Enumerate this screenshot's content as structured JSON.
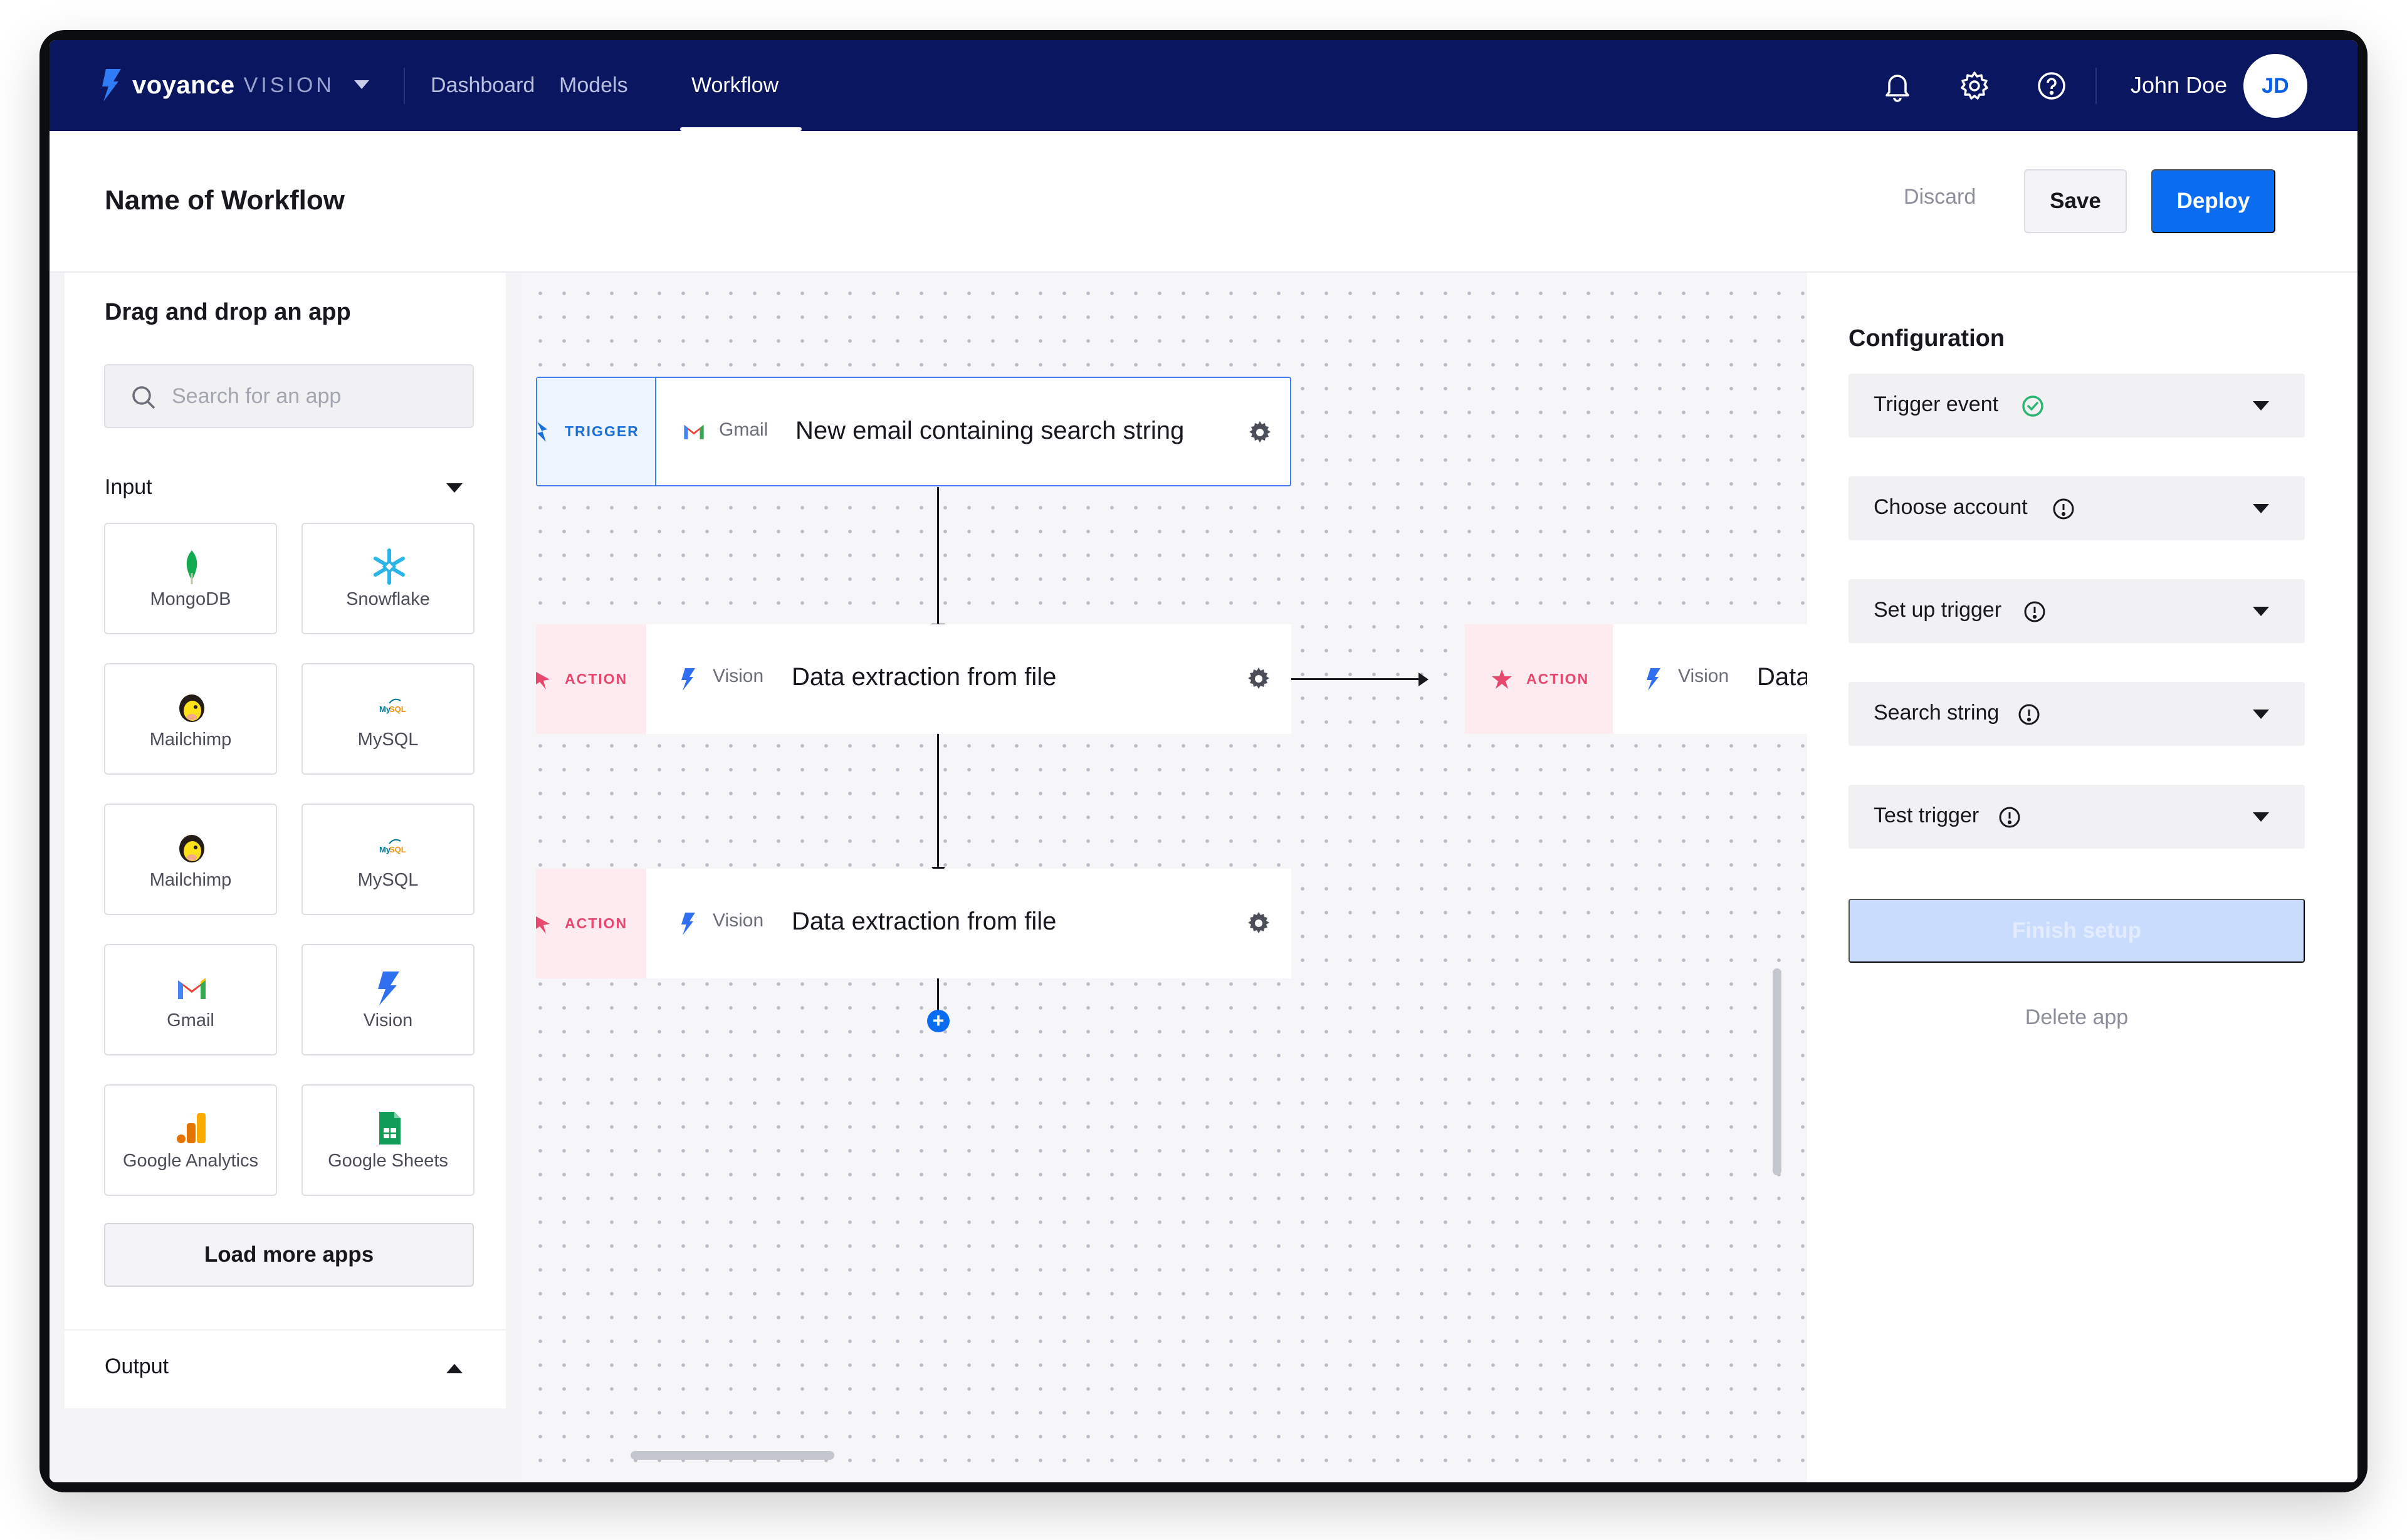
{
  "nav": {
    "brand_name": "voyance",
    "brand_suffix": "VISION",
    "links": [
      "Dashboard",
      "Models",
      "Workflow"
    ],
    "active": "Workflow",
    "user_name": "John Doe",
    "user_initials": "JD",
    "icons": [
      "bell-icon",
      "gear-icon",
      "help-icon"
    ]
  },
  "header": {
    "title": "Name of Workflow",
    "discard_label": "Discard",
    "save_label": "Save",
    "deploy_label": "Deploy"
  },
  "sidebar": {
    "title": "Drag and drop an app",
    "search_placeholder": "Search for an app",
    "input_section": "Input",
    "output_section": "Output",
    "apps": [
      {
        "name": "MongoDB",
        "icon": "mongodb-icon"
      },
      {
        "name": "Snowflake",
        "icon": "snowflake-icon"
      },
      {
        "name": "Mailchimp",
        "icon": "mailchimp-icon"
      },
      {
        "name": "MySQL",
        "icon": "mysql-icon"
      },
      {
        "name": "Mailchimp",
        "icon": "mailchimp-icon"
      },
      {
        "name": "MySQL",
        "icon": "mysql-icon"
      },
      {
        "name": "Gmail",
        "icon": "gmail-icon"
      },
      {
        "name": "Vision",
        "icon": "vision-icon"
      },
      {
        "name": "Google Analytics",
        "icon": "google-analytics-icon"
      },
      {
        "name": "Google Sheets",
        "icon": "google-sheets-icon"
      }
    ],
    "load_more_label": "Load more apps"
  },
  "canvas": {
    "nodes": [
      {
        "tag": "TRIGGER",
        "app": "Gmail",
        "text": "New email containing search string"
      },
      {
        "tag": "ACTION",
        "app": "Vision",
        "text": "Data extraction from file"
      },
      {
        "tag": "ACTION",
        "app": "Vision",
        "text": "Data extraction from file"
      },
      {
        "tag": "ACTION",
        "app": "Vision",
        "text": "Data"
      }
    ],
    "add_symbol": "+"
  },
  "config": {
    "title": "Configuration",
    "rows": [
      {
        "label": "Trigger event",
        "status": "complete"
      },
      {
        "label": "Choose account",
        "status": "info"
      },
      {
        "label": "Set up trigger",
        "status": "info"
      },
      {
        "label": "Search string",
        "status": "info"
      },
      {
        "label": "Test trigger",
        "status": "info"
      }
    ],
    "finish_label": "Finish setup",
    "delete_label": "Delete app"
  },
  "colors": {
    "nav_bg": "#0a1660",
    "primary": "#0a6cf0",
    "trigger_accent": "#1a6fd8",
    "action_accent": "#e8476e",
    "success": "#2bb673"
  }
}
